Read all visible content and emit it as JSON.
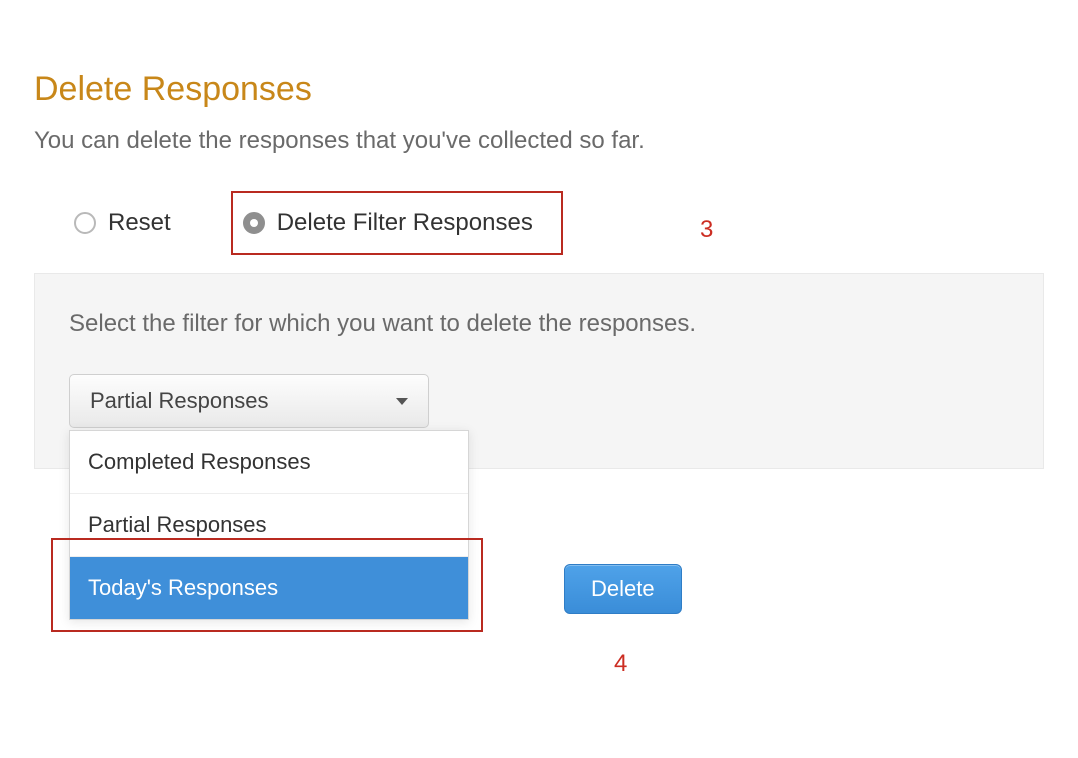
{
  "title": "Delete Responses",
  "subtitle": "You can delete the responses that you've collected so far.",
  "radios": {
    "reset": {
      "label": "Reset",
      "checked": false
    },
    "deleteFilter": {
      "label": "Delete Filter Responses",
      "checked": true
    }
  },
  "callouts": {
    "top": "3",
    "bottom": "4"
  },
  "panel": {
    "description": "Select the filter for which you want to delete the responses.",
    "select": {
      "selected": "Partial Responses",
      "options": [
        "Completed Responses",
        "Partial Responses",
        "Today's Responses"
      ],
      "highlighted": "Today's Responses"
    },
    "deleteLabel": "Delete"
  }
}
